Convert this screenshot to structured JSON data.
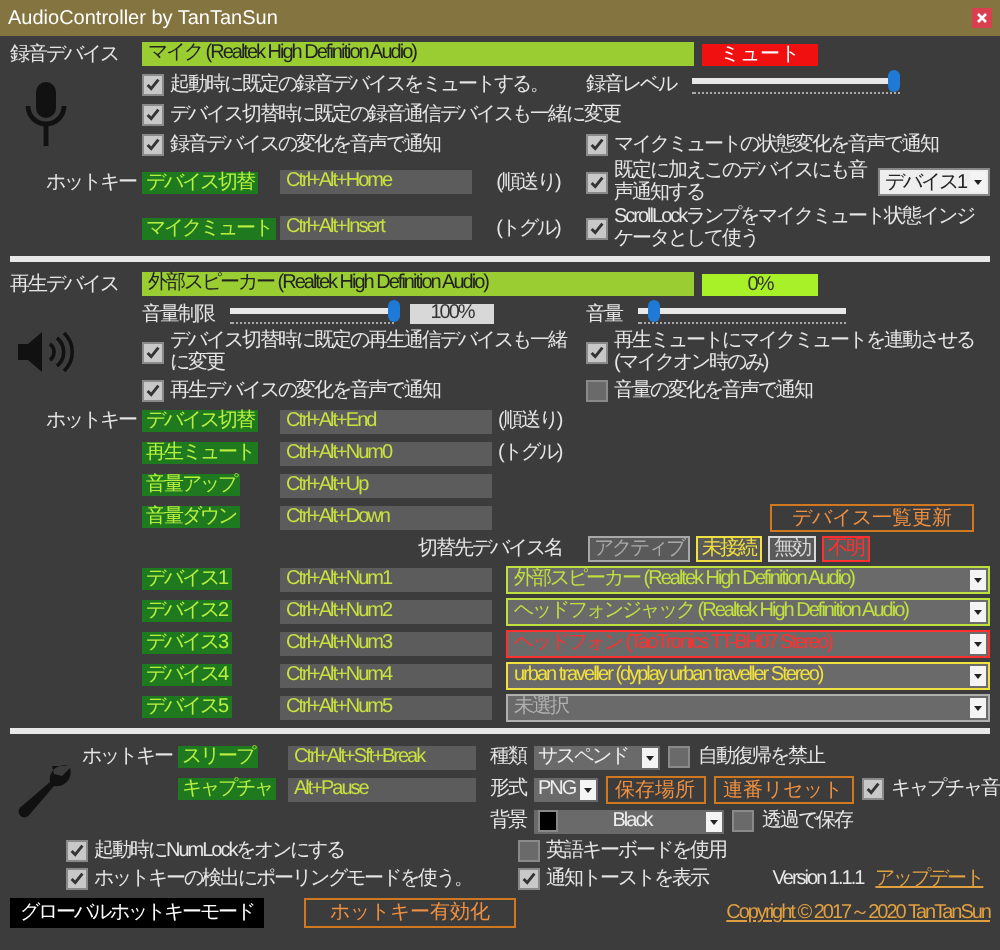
{
  "window": {
    "title": "AudioController by TanTanSun"
  },
  "recording": {
    "label": "録音デバイス",
    "device": "マイク (Realtek High Definition Audio)",
    "mute_button": {
      "label": "ミュート",
      "on": true
    },
    "level_label": "録音レベル",
    "level": 0.97,
    "options": [
      {
        "label": "起動時に既定の録音デバイスをミュートする。",
        "checked": true
      },
      {
        "label": "デバイス切替時に既定の録音通信デバイスも一緒に変更",
        "checked": true
      },
      {
        "label": "録音デバイスの変化を音声で通知",
        "checked": true
      }
    ],
    "options_right": [
      {
        "label": "マイクミュートの状態変化を音声で通知",
        "checked": true
      },
      {
        "label": "既定に加えこのデバイスにも音声通知する",
        "checked": true
      },
      {
        "label": "ScrollLockランプをマイクミュート状態インジケータとして使う",
        "checked": true
      }
    ],
    "notify_device": "デバイス1",
    "hotkey_label": "ホットキー",
    "hotkeys": [
      {
        "name": "デバイス切替",
        "keys": "Ctrl+Alt+Home",
        "note": "(順送り)"
      },
      {
        "name": "マイクミュート",
        "keys": "Ctrl+Alt+Insert",
        "note": "(トグル)"
      }
    ]
  },
  "playback": {
    "label": "再生デバイス",
    "device": "外部スピーカー (Realtek High Definition Audio)",
    "meter_reading": "0%",
    "limit": {
      "label": "音量制限",
      "level": 1.0,
      "reading": "100%"
    },
    "volume": {
      "label": "音量",
      "level": 0.08
    },
    "options": [
      {
        "label": "デバイス切替時に既定の再生通信デバイスも一緒に変更",
        "checked": true
      },
      {
        "label": "再生デバイスの変化を音声で通知",
        "checked": true
      }
    ],
    "options_right": [
      {
        "label": "再生ミュートにマイクミュートを連動させる (マイクオン時のみ)",
        "checked": true
      },
      {
        "label": "音量の変化を音声で通知",
        "checked": false
      }
    ],
    "hotkey_label": "ホットキー",
    "hotkeys": [
      {
        "name": "デバイス切替",
        "keys": "Ctrl+Alt+End",
        "note": "(順送り)"
      },
      {
        "name": "再生ミュート",
        "keys": "Ctrl+Alt+Num0",
        "note": "(トグル)"
      },
      {
        "name": "音量アップ",
        "keys": "Ctrl+Alt+Up"
      },
      {
        "name": "音量ダウン",
        "keys": "Ctrl+Alt+Down"
      }
    ],
    "refresh_button": "デバイス一覧更新",
    "target_label": "切替先デバイス名",
    "legend": [
      {
        "label": "アクティブ",
        "color": "#a8a8a8"
      },
      {
        "label": "未接続",
        "color": "#f0e040"
      },
      {
        "label": "無効",
        "color": "#d8d8d8"
      },
      {
        "label": "不明",
        "color": "#ff3030"
      }
    ],
    "devices": [
      {
        "name": "デバイス1",
        "keys": "Ctrl+Alt+Num1",
        "target": "外部スピーカー (Realtek High Definition Audio)",
        "color": "#c0e040"
      },
      {
        "name": "デバイス2",
        "keys": "Ctrl+Alt+Num2",
        "target": "ヘッドフォンジャック (Realtek High Definition Audio)",
        "color": "#c0e040"
      },
      {
        "name": "デバイス3",
        "keys": "Ctrl+Alt+Num3",
        "target": "ヘッドフォン (TaoTronics TT-BH07 Stereo)",
        "color": "#ff3030"
      },
      {
        "name": "デバイス4",
        "keys": "Ctrl+Alt+Num4",
        "target": "urban traveller (dyplay urban traveller Stereo)",
        "color": "#f0e040"
      },
      {
        "name": "デバイス5",
        "keys": "Ctrl+Alt+Num5",
        "target": "未選択",
        "color": "#b0b0b0"
      }
    ]
  },
  "misc": {
    "hotkey_label": "ホットキー",
    "hotkeys": [
      {
        "name": "スリープ",
        "keys": "Ctrl+Alt+Sft+Break"
      },
      {
        "name": "キャプチャ",
        "keys": "Alt+Pause"
      }
    ],
    "sleep_label": "種類",
    "sleep_value": "サスペンド",
    "no_wake": {
      "label": "自動復帰を禁止",
      "checked": false
    },
    "format_label": "形式",
    "format_value": "PNG",
    "buttons": [
      "保存場所",
      "連番リセット"
    ],
    "capture_sound": {
      "label": "キャプチャ音",
      "checked": true
    },
    "background": {
      "label": "背景",
      "value": "Black",
      "color": "#000000"
    },
    "transparent": {
      "label": "透過で保存",
      "checked": false
    },
    "options": [
      {
        "label": "起動時にNumLockをオンにする",
        "checked": true
      },
      {
        "label": "ホットキーの検出にポーリングモードを使う。",
        "checked": true
      }
    ],
    "options_right": [
      {
        "label": "英語キーボードを使用",
        "checked": false
      },
      {
        "label": "通知トーストを表示",
        "checked": true
      }
    ],
    "version": "Version 1.1.1",
    "update_link": "アップデート"
  },
  "footer": {
    "mode_label": "グローバルホットキーモード",
    "toggle_button": "ホットキー有効化",
    "copyright": "Copyright © 2017～2020 TanTanSun"
  }
}
